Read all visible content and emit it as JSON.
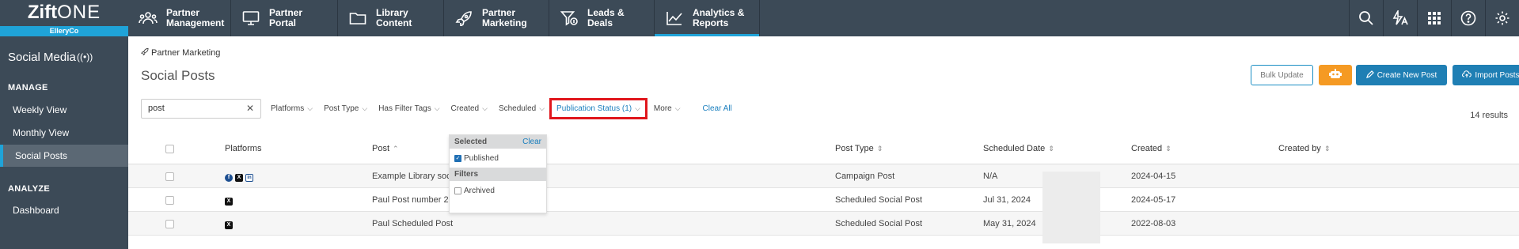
{
  "logo": {
    "brand_bold": "Zift",
    "brand_light": "ONE",
    "company": "ElleryCo"
  },
  "nav": [
    {
      "label": "Partner\nManagement",
      "icon": "people-icon"
    },
    {
      "label": "Partner\nPortal",
      "icon": "monitor-icon"
    },
    {
      "label": "Library\nContent",
      "icon": "folder-icon"
    },
    {
      "label": "Partner\nMarketing",
      "icon": "rocket-icon"
    },
    {
      "label": "Leads &\nDeals",
      "icon": "funnel-dollar-icon"
    },
    {
      "label": "Analytics &\nReports",
      "icon": "chart-line-icon"
    }
  ],
  "tools": [
    "search-icon",
    "flash-translate-icon",
    "apps-grid-icon",
    "help-icon",
    "settings-icon"
  ],
  "sidebar": {
    "title": "Social Media",
    "title_icon": "broadcast-icon",
    "manage_label": "MANAGE",
    "manage_items": [
      "Weekly View",
      "Monthly View",
      "Social Posts"
    ],
    "analyze_label": "ANALYZE",
    "analyze_items": [
      "Dashboard"
    ]
  },
  "breadcrumb": {
    "icon": "rocket-icon",
    "label": "Partner Marketing"
  },
  "page_title": "Social Posts",
  "buttons": {
    "bulk_update": "Bulk Update",
    "robot_icon": "robot-icon",
    "create": "Create New Post",
    "import": "Import Posts"
  },
  "search": {
    "value": "post"
  },
  "filters": [
    {
      "label": "Platforms",
      "active": false
    },
    {
      "label": "Post Type",
      "active": false
    },
    {
      "label": "Has Filter Tags",
      "active": false
    },
    {
      "label": "Created",
      "active": false
    },
    {
      "label": "Scheduled",
      "active": false
    },
    {
      "label": "Publication Status (1)",
      "active": true
    },
    {
      "label": "More",
      "active": false
    }
  ],
  "clear_all": "Clear All",
  "results": "14 results",
  "table": {
    "headers": {
      "platforms": "Platforms",
      "post": "Post",
      "post_type": "Post Type",
      "scheduled_date": "Scheduled Date",
      "created": "Created",
      "created_by": "Created by"
    },
    "rows": [
      {
        "platforms": [
          "facebook",
          "x",
          "linkedin"
        ],
        "post": "Example Library social post",
        "post_type": "Campaign Post",
        "scheduled_date": "N/A",
        "created": "2024-04-15"
      },
      {
        "platforms": [
          "x"
        ],
        "post": "Paul Post number 2",
        "post_type": "Scheduled Social Post",
        "scheduled_date": "Jul 31, 2024",
        "created": "2024-05-17"
      },
      {
        "platforms": [
          "x"
        ],
        "post": "Paul Scheduled Post",
        "post_type": "Scheduled Social Post",
        "scheduled_date": "May 31, 2024",
        "created": "2022-08-03"
      }
    ]
  },
  "dropdown": {
    "selected_label": "Selected",
    "clear": "Clear",
    "selected_options": [
      {
        "label": "Published",
        "checked": true
      }
    ],
    "filters_label": "Filters",
    "filter_options": [
      {
        "label": "Archived",
        "checked": false
      }
    ]
  },
  "colors": {
    "nav_bg": "#3c4a57",
    "accent": "#1fa3d8",
    "primary": "#1f7fb4",
    "orange": "#f59a23",
    "highlight": "#e0161c"
  }
}
